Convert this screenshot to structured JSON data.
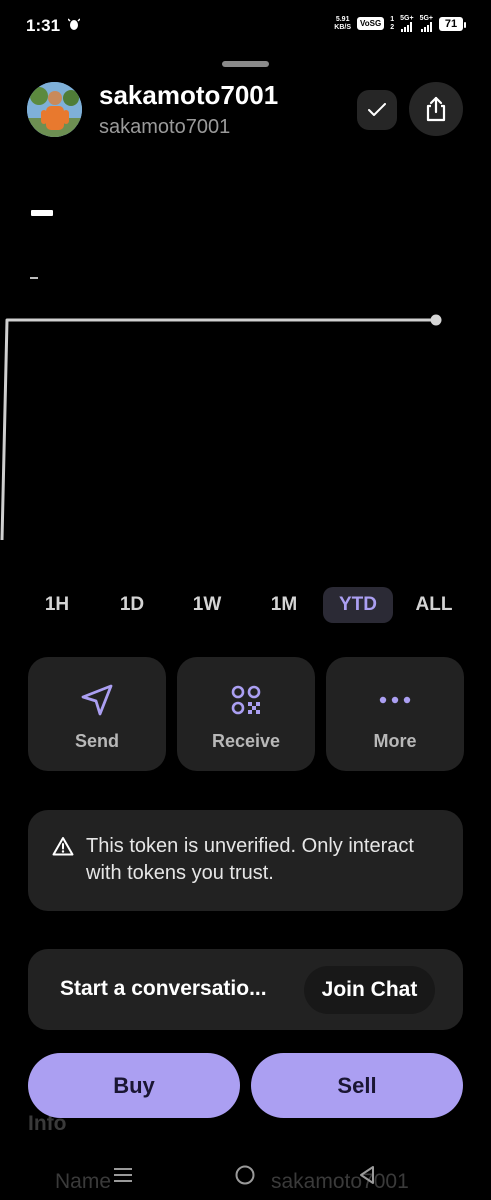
{
  "status_bar": {
    "time": "1:31",
    "net_speed_value": "5.91",
    "net_speed_unit": "KB/S",
    "volte_badge": "VoSG",
    "sim_slot_1": "1",
    "sim_slot_2": "2",
    "signal_1_label": "5G+",
    "signal_2_label": "5G+",
    "battery": "71"
  },
  "profile": {
    "name": "sakamoto7001",
    "handle": "sakamoto7001"
  },
  "chart_data": {
    "type": "line",
    "title": "",
    "xlabel": "",
    "ylabel": "",
    "grid": false,
    "series": [
      {
        "values": [
          0,
          100,
          100,
          100,
          100
        ]
      }
    ],
    "ylim": [
      0,
      100
    ]
  },
  "time_ranges": {
    "items": [
      "1H",
      "1D",
      "1W",
      "1M",
      "YTD",
      "ALL"
    ],
    "selected": "YTD"
  },
  "actions": {
    "send": "Send",
    "receive": "Receive",
    "more": "More"
  },
  "warning": {
    "text": "This token is unverified. Only interact with tokens you trust."
  },
  "chat": {
    "prompt": "Start a conversatio...",
    "join_label": "Join Chat"
  },
  "underlay": {
    "info_label": "Info",
    "name_label": "Name",
    "name_value": "sakamoto7001"
  },
  "trade": {
    "buy_label": "Buy",
    "sell_label": "Sell"
  },
  "colors": {
    "accent": "#ab9ff2",
    "card": "#222222",
    "background": "#000000"
  }
}
